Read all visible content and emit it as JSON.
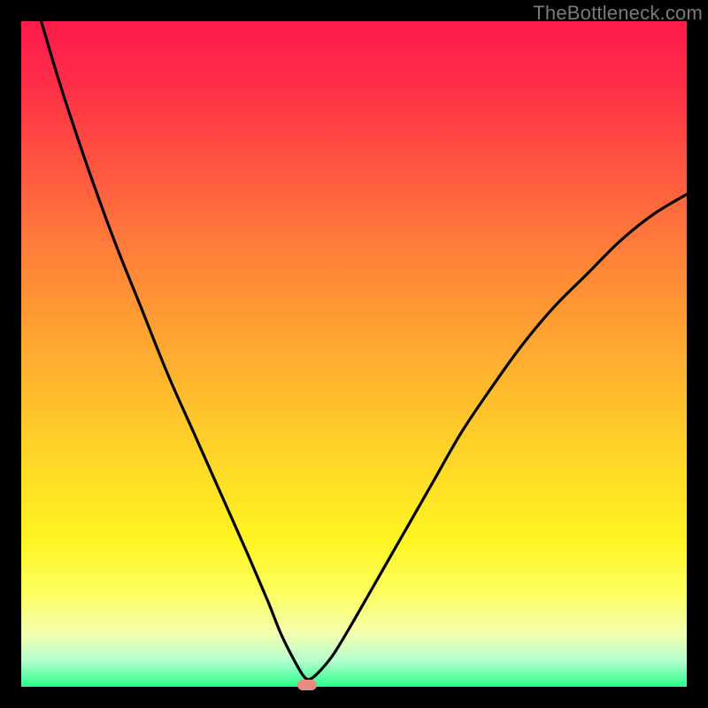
{
  "watermark": "TheBottleneck.com",
  "colors": {
    "frame": "#000000",
    "gradient_top": "#ff1a4a",
    "gradient_bottom": "#2bff8c",
    "curve": "#000000",
    "marker": "#e98b84"
  },
  "chart_data": {
    "type": "line",
    "title": "",
    "xlabel": "",
    "ylabel": "",
    "xlim": [
      0,
      100
    ],
    "ylim": [
      0,
      100
    ],
    "grid": false,
    "legend": false,
    "marker": {
      "x": 43,
      "y": 0
    },
    "series": [
      {
        "name": "curve",
        "x": [
          3,
          6,
          10,
          14,
          18,
          22,
          26,
          30,
          34,
          37,
          39,
          41,
          42.5,
          43.5,
          45,
          47,
          50,
          54,
          58,
          62,
          66,
          70,
          75,
          80,
          85,
          90,
          95,
          100
        ],
        "y": [
          100,
          90,
          78,
          67,
          57,
          47,
          38,
          29,
          20,
          13,
          8,
          4,
          1.5,
          1.2,
          2.5,
          5,
          10,
          17,
          24,
          31,
          38,
          44,
          51,
          57,
          62,
          67,
          71,
          74
        ]
      }
    ]
  }
}
